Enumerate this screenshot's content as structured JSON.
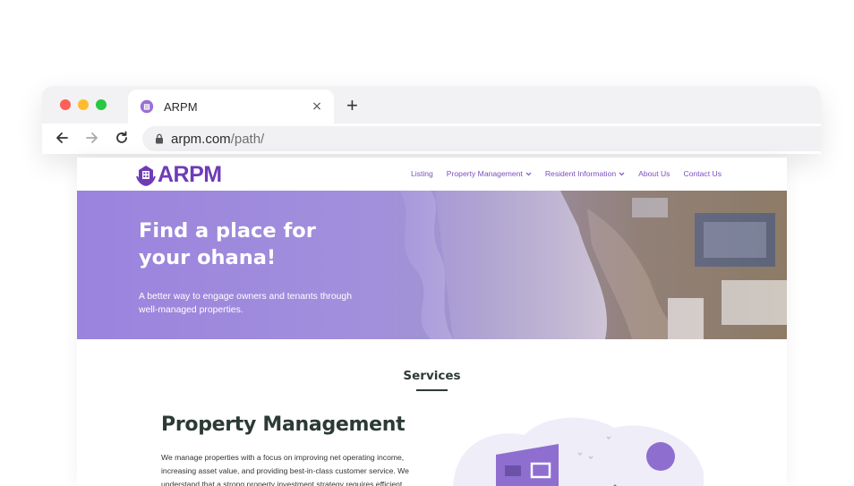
{
  "browser": {
    "tab_title": "ARPM",
    "tab_close": "×",
    "new_tab": "+",
    "url_host": "arpm.com",
    "url_path": "/path/"
  },
  "site": {
    "logo_text": "ARPM",
    "nav": [
      {
        "label": "Listing",
        "has_dropdown": false
      },
      {
        "label": "Property Management",
        "has_dropdown": true
      },
      {
        "label": "Resident Information",
        "has_dropdown": true
      },
      {
        "label": "About Us",
        "has_dropdown": false
      },
      {
        "label": "Contact Us",
        "has_dropdown": false
      }
    ],
    "hero": {
      "title_line1": "Find a place for",
      "title_line2": "your ohana!",
      "subtitle_line1": "A better way to engage owners and tenants through",
      "subtitle_line2": "well-managed properties."
    },
    "services_title": "Services",
    "section": {
      "title": "Property Management",
      "body_line1": "We manage properties with a focus on improving net operating income,",
      "body_line2": "increasing asset value, and providing best-in-class customer service. We",
      "body_line3": "understand that a strong property investment strategy requires efficient"
    }
  },
  "colors": {
    "brand_purple": "#6f3bb6",
    "hero_purple": "#9a83de",
    "dark_text": "#2c3a36",
    "traffic_red": "#fe5f57",
    "traffic_yellow": "#febc2e",
    "traffic_green": "#28c840"
  },
  "icons": [
    "logo-icon",
    "tab-favicon",
    "back-arrow-icon",
    "forward-arrow-icon",
    "reload-icon",
    "lock-icon",
    "chevron-down-icon"
  ]
}
